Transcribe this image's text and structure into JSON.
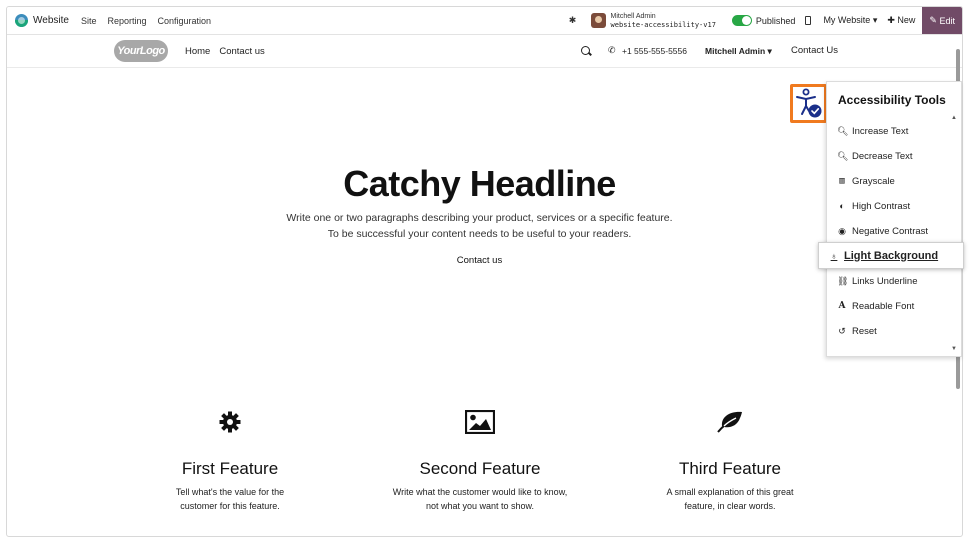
{
  "topbar": {
    "brand": "Website",
    "menu": [
      "Site",
      "Reporting",
      "Configuration"
    ],
    "user_name": "Mitchell Admin",
    "database": "website-accessibility-v17",
    "published_label": "Published",
    "my_website_label": "My Website",
    "new_label": "New",
    "edit_label": "Edit"
  },
  "header": {
    "logo_text": "YourLogo",
    "nav": [
      "Home",
      "Contact us"
    ],
    "phone": "+1 555-555-5556",
    "user": "Mitchell Admin",
    "contact_button": "Contact Us"
  },
  "hero": {
    "title": "Catchy Headline",
    "line1": "Write one or two paragraphs describing your product, services or a specific feature.",
    "line2": "To be successful your content needs to be useful to your readers.",
    "cta": "Contact us"
  },
  "features": [
    {
      "icon": "gear-icon",
      "title": "First Feature",
      "line1": "Tell what's the value for the",
      "line2": "customer for this feature."
    },
    {
      "icon": "picture-icon",
      "title": "Second Feature",
      "line1": "Write what the customer would like to know,",
      "line2": "not what you want to show."
    },
    {
      "icon": "leaf-icon",
      "title": "Third Feature",
      "line1": "A small explanation of this great",
      "line2": "feature, in clear words."
    }
  ],
  "accessibility": {
    "title": "Accessibility Tools",
    "items": [
      {
        "label": "Increase Text",
        "icon": "zoom-in-icon"
      },
      {
        "label": "Decrease Text",
        "icon": "zoom-out-icon"
      },
      {
        "label": "Grayscale",
        "icon": "barcode-icon"
      },
      {
        "label": "High Contrast",
        "icon": "contrast-icon"
      },
      {
        "label": "Negative Contrast",
        "icon": "eye-icon"
      },
      {
        "label": "Light Background",
        "icon": "lightbulb-icon"
      },
      {
        "label": "Links Underline",
        "icon": "link-icon"
      },
      {
        "label": "Readable Font",
        "icon": "font-icon"
      },
      {
        "label": "Reset",
        "icon": "reset-icon"
      }
    ],
    "active_item": "Light Background"
  },
  "colors": {
    "edit_bg": "#714b67",
    "published_toggle": "#28a745",
    "a11y_highlight": "#f07a1f",
    "a11y_icon": "#1a2f8a"
  }
}
